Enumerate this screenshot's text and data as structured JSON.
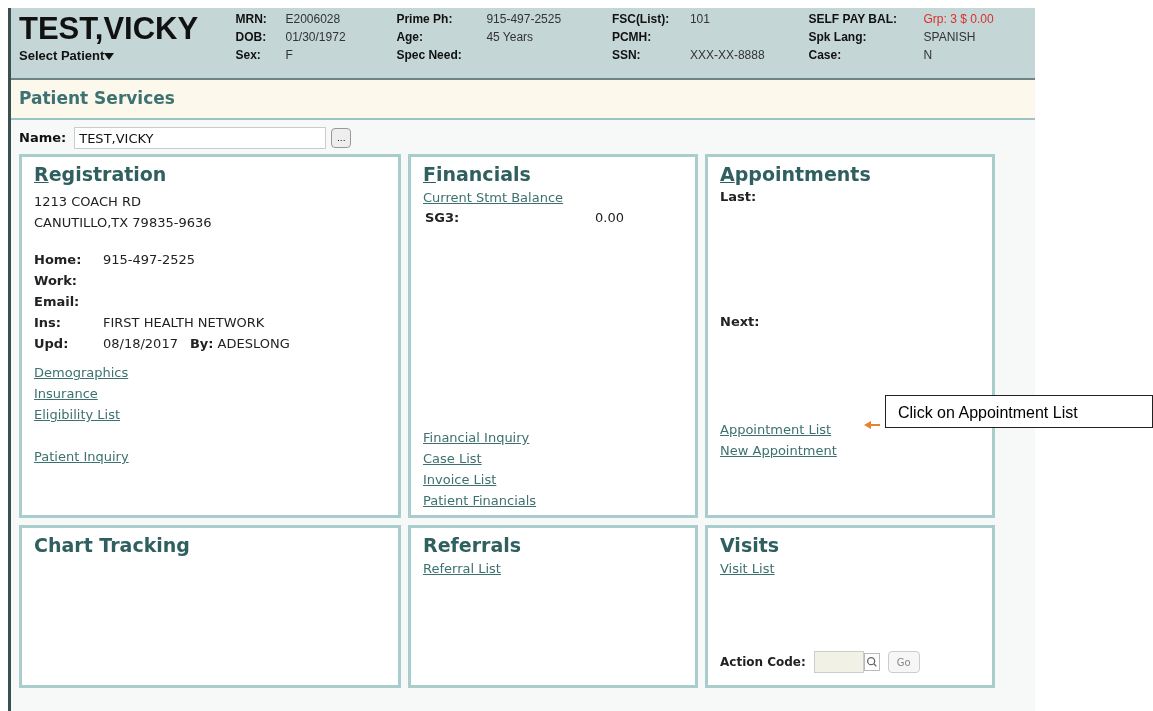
{
  "header": {
    "patient_name": "TEST,VICKY",
    "select_label": "Select Patient",
    "columns": [
      [
        {
          "label": "MRN:",
          "value": "E2006028"
        },
        {
          "label": "DOB:",
          "value": "01/30/1972"
        },
        {
          "label": "Sex:",
          "value": "F"
        }
      ],
      [
        {
          "label": "Prime Ph:",
          "value": "915-497-2525"
        },
        {
          "label": "Age:",
          "value": "45 Years"
        },
        {
          "label": "Spec Need:"
        }
      ],
      [
        {
          "label": "FSC(List):",
          "value": "101"
        },
        {
          "label": "PCMH:"
        },
        {
          "label": "SSN:",
          "value": "XXX-XX-8888"
        }
      ],
      [
        {
          "label": "SELF PAY BAL:",
          "value": "Grp: 3 $ 0.00",
          "alert": true
        },
        {
          "label": "Spk Lang:",
          "value": "SPANISH"
        },
        {
          "label": "Case:",
          "value": "N"
        }
      ]
    ]
  },
  "page_title": "Patient Services",
  "name_field": {
    "label": "Name:",
    "value": "TEST,VICKY",
    "browse": "..."
  },
  "panels": [
    {
      "kind": "registration",
      "title": "Registration",
      "accelerator": true,
      "address": [
        "1213 COACH RD",
        "CANUTILLO,TX 79835-9636"
      ],
      "contacts": [
        {
          "label": "Home:",
          "value": "915-497-2525"
        },
        {
          "label": "Work:"
        },
        {
          "label": "Email:"
        },
        {
          "label": "Ins:",
          "value": "FIRST HEALTH NETWORK"
        }
      ],
      "updated": {
        "label": "Upd:",
        "value": "08/18/2017",
        "by_label": "By:",
        "by_value": "ADESLONG"
      },
      "link_groups": [
        [
          "Demographics",
          "Insurance",
          "Eligibility List"
        ],
        [
          "Patient Inquiry"
        ]
      ]
    },
    {
      "kind": "financials",
      "title": "Financials",
      "accelerator": true,
      "top_link": "Current Stmt Balance",
      "balance": {
        "label": "SG3:",
        "value": "0.00"
      },
      "links": [
        "Financial Inquiry",
        "Case List",
        "Invoice List",
        "Patient Financials"
      ]
    },
    {
      "kind": "appointments",
      "title": "Appointments",
      "accelerator": true,
      "last_label": "Last:",
      "next_label": "Next:",
      "links": [
        "Appointment List",
        "New Appointment"
      ],
      "callout": "Click on Appointment List"
    },
    {
      "kind": "chart",
      "title": "Chart Tracking",
      "accelerator": false
    },
    {
      "kind": "referrals",
      "title": "Referrals",
      "accelerator": false,
      "links": [
        "Referral List"
      ]
    },
    {
      "kind": "visits",
      "title": "Visits",
      "accelerator": false,
      "links": [
        "Visit List"
      ],
      "action_label": "Action Code:",
      "go": "Go"
    }
  ]
}
